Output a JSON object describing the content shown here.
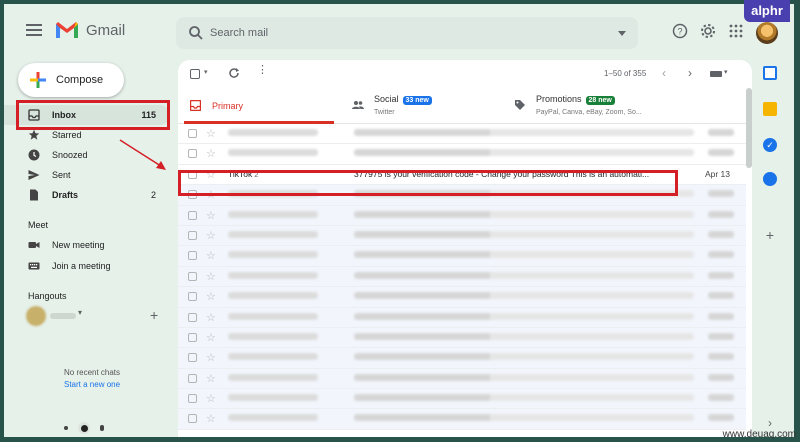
{
  "watermark": "alphr",
  "footer_watermark": "www.deuaq.com",
  "app": {
    "name": "Gmail"
  },
  "search": {
    "placeholder": "Search mail"
  },
  "compose": {
    "label": "Compose"
  },
  "sidebar": {
    "items": [
      {
        "label": "Inbox",
        "count": "115",
        "icon": "inbox-icon"
      },
      {
        "label": "Starred",
        "count": "",
        "icon": "star-icon"
      },
      {
        "label": "Snoozed",
        "count": "",
        "icon": "clock-icon"
      },
      {
        "label": "Sent",
        "count": "",
        "icon": "send-icon"
      },
      {
        "label": "Drafts",
        "count": "2",
        "icon": "draft-icon"
      }
    ],
    "meet": {
      "title": "Meet",
      "items": [
        {
          "label": "New meeting",
          "icon": "video-icon"
        },
        {
          "label": "Join a meeting",
          "icon": "keyboard-icon"
        }
      ]
    },
    "hangouts": {
      "title": "Hangouts",
      "no_chats": "No recent chats",
      "start_new": "Start a new one"
    }
  },
  "toolbar": {
    "pagination": "1–50 of 355"
  },
  "tabs": [
    {
      "label": "Primary",
      "badge": "",
      "subtitle": ""
    },
    {
      "label": "Social",
      "badge": "33 new",
      "subtitle": "Twitter"
    },
    {
      "label": "Promotions",
      "badge": "28 new",
      "subtitle": "PayPal, Canva, eBay, Zoom, So..."
    }
  ],
  "colors": {
    "accent_red": "#d93025",
    "social_badge": "#1a73e8",
    "promo_badge": "#188038",
    "highlight": "#d41f26"
  },
  "highlighted_email": {
    "sender": "TikTok",
    "thread_count": "2",
    "subject": "377975 is your verification code - Change your password This is an automati...",
    "date": "Apr 13"
  }
}
